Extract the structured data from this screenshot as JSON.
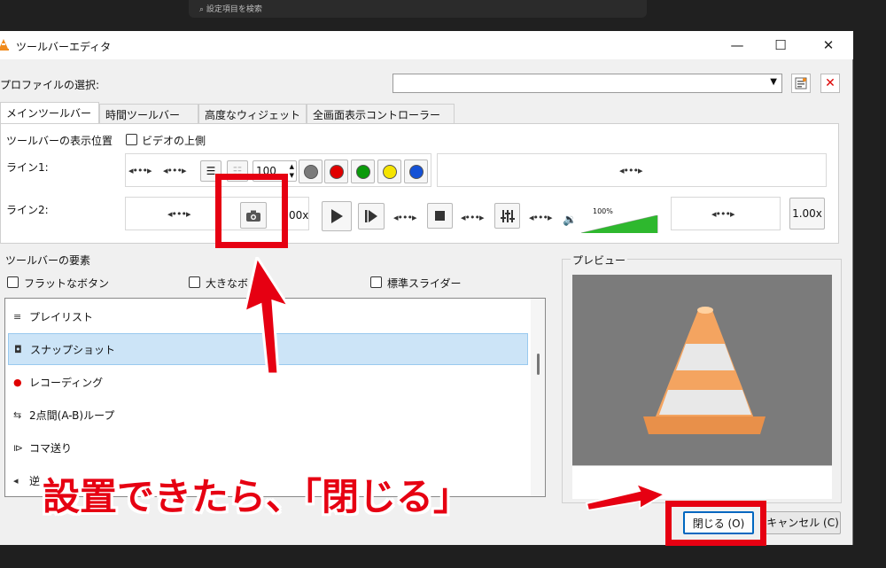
{
  "desktop": {
    "search_placeholder": "設定項目を検索"
  },
  "window": {
    "title": "ツールバーエディタ",
    "minimize": "—",
    "maximize": "☐",
    "close": "✕"
  },
  "profile": {
    "label": "プロファイルの選択:",
    "value": ""
  },
  "tabs": [
    {
      "label": "メインツールバー"
    },
    {
      "label": "時間ツールバー"
    },
    {
      "label": "高度なウィジェット"
    },
    {
      "label": "全画面表示コントローラー"
    }
  ],
  "main_toolbar": {
    "position_label": "ツールバーの表示位置",
    "video_top_label": "ビデオの上側",
    "line1_label": "ライン1:",
    "line2_label": "ライン2:",
    "spinner_value": "100",
    "speed_label": "1.00x",
    "speed_label_partial": "00x",
    "volume_pct": "100%",
    "volume_fraction": 1.0
  },
  "elements": {
    "label": "ツールバーの要素",
    "flat_buttons": "フラットなボタン",
    "big_buttons": "大きなボ",
    "standard_slider": "標準スライダー",
    "items": [
      {
        "icon": "≡",
        "label": "プレイリスト"
      },
      {
        "icon": "◘",
        "label": "スナップショット",
        "selected": true
      },
      {
        "icon": "●",
        "label": "レコーディング"
      },
      {
        "icon": "⇆",
        "label": "2点間(A-B)ループ"
      },
      {
        "icon": "⧐",
        "label": "コマ送り"
      },
      {
        "icon": "◂",
        "label": "逆"
      }
    ]
  },
  "preview": {
    "label": "プレビュー"
  },
  "buttons": {
    "close": "閉じる (O)",
    "cancel": "キャンセル (C)"
  },
  "annotation": {
    "text": "設置できたら、「閉じる」"
  },
  "colors": {
    "accent_red": "#e60012",
    "selection": "#cce4f7"
  }
}
